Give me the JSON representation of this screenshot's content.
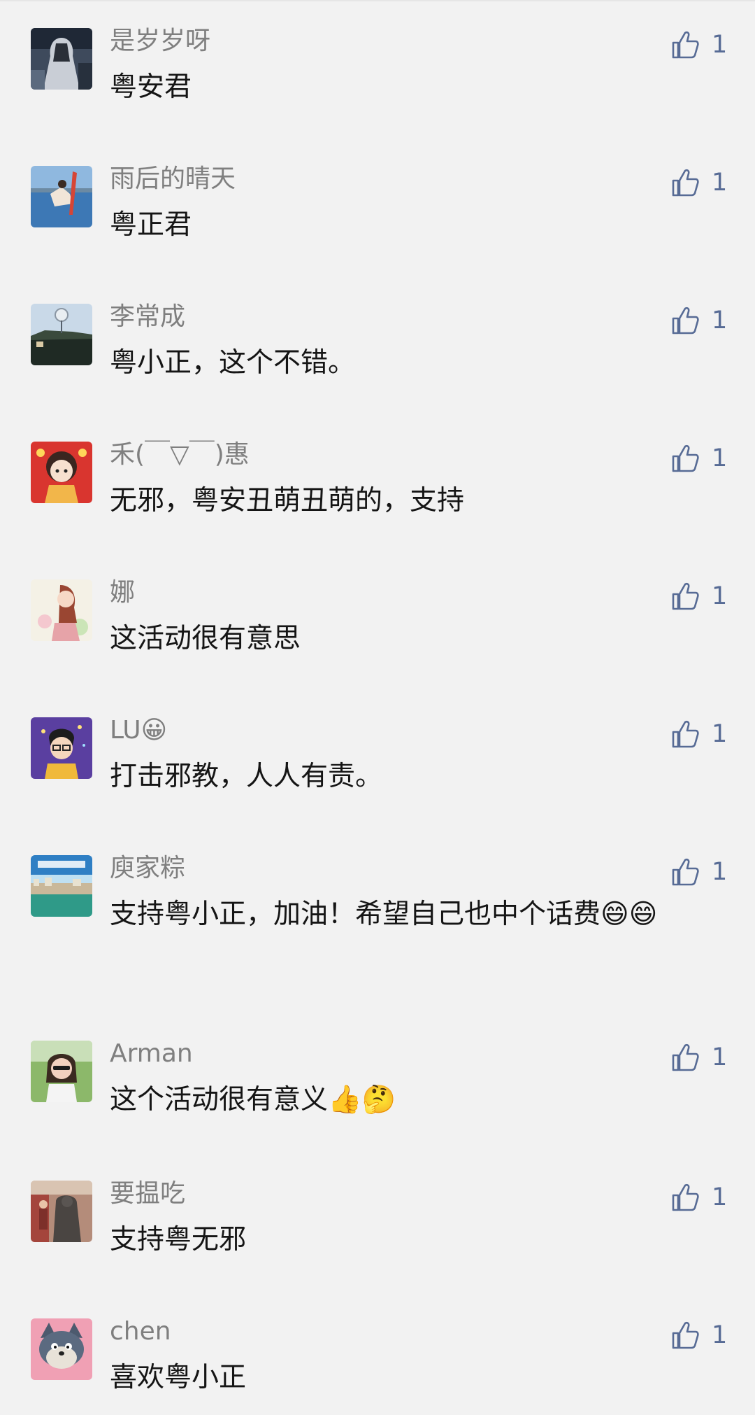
{
  "colors": {
    "background": "#f2f2f2",
    "nickname": "#7f7f7f",
    "text": "#151515",
    "like": "#576b95"
  },
  "comments": [
    {
      "name": "是岁岁呀",
      "text": "粤安君",
      "likes": "1",
      "avatar": "avatar-dark-figure"
    },
    {
      "name": "雨后的晴天",
      "text": "粤正君",
      "likes": "1",
      "avatar": "avatar-sea-photo"
    },
    {
      "name": "李常成",
      "text": "粤小正，这个不错。",
      "likes": "1",
      "avatar": "avatar-building-photo"
    },
    {
      "name": "禾(￣▽￣)惠",
      "text": "无邪，粤安丑萌丑萌的，支持",
      "likes": "1",
      "avatar": "avatar-cartoon-girl"
    },
    {
      "name": "娜",
      "text": "这活动很有意思",
      "likes": "1",
      "avatar": "avatar-watercolor-girl"
    },
    {
      "name": "LU😀",
      "text": "打击邪教，人人有责。",
      "likes": "1",
      "avatar": "avatar-cartoon-boy"
    },
    {
      "name": "庾家粽",
      "text": "支持粤小正，加油！希望自己也中个话费😄😄",
      "likes": "1",
      "avatar": "avatar-landscape-photo"
    },
    {
      "name": "Arman",
      "text": "这个活动很有意义👍🤔",
      "likes": "1",
      "avatar": "avatar-woman-photo"
    },
    {
      "name": "要揾吃",
      "text": "支持粤无邪",
      "likes": "1",
      "avatar": "avatar-statue-photo"
    },
    {
      "name": "chen",
      "text": "喜欢粤小正",
      "likes": "1",
      "avatar": "avatar-cartoon-cat"
    }
  ]
}
